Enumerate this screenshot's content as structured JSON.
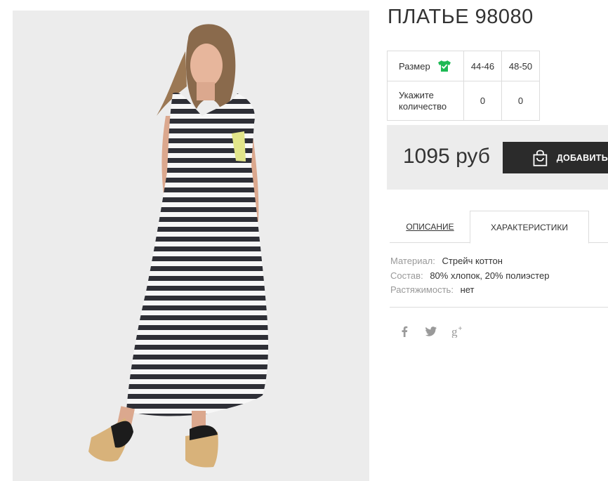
{
  "product": {
    "title": "ПЛАТЬЕ 98080"
  },
  "sizes": {
    "header_label": "Размер",
    "columns": [
      "44-46",
      "48-50"
    ],
    "quantity_label_line1": "Укажите",
    "quantity_label_line2": "количество",
    "quantities": [
      "0",
      "0"
    ]
  },
  "buy": {
    "price": "1095 руб",
    "add_button_label": "ДОБАВИТЬ"
  },
  "tabs": {
    "description": "ОПИСАНИЕ",
    "characteristics": "ХАРАКТЕРИСТИКИ",
    "active": "characteristics"
  },
  "characteristics": [
    {
      "key": "Материал:",
      "value": "Стрейч коттон"
    },
    {
      "key": "Состав:",
      "value": "80% хлопок, 20% полиэстер"
    },
    {
      "key": "Растяжимость:",
      "value": "нет"
    }
  ],
  "social": {
    "icons": [
      "facebook-icon",
      "twitter-icon",
      "google-plus-icon"
    ]
  },
  "colors": {
    "accent_green": "#1db954",
    "button_dark": "#2b2b2b",
    "panel_gray": "#ececec"
  }
}
